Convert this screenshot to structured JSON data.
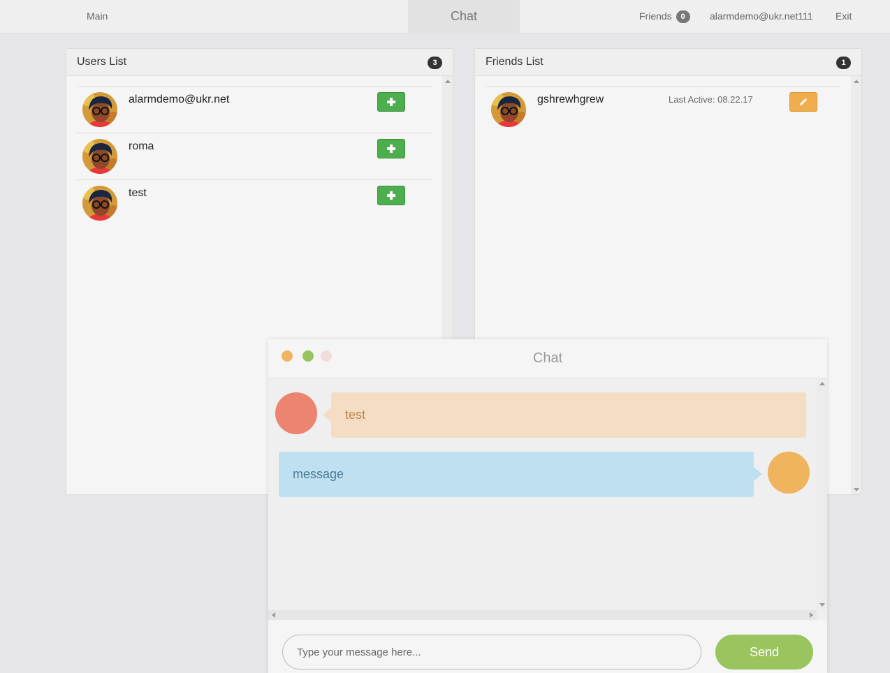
{
  "navbar": {
    "main": "Main",
    "chat": "Chat",
    "friends": "Friends",
    "friends_count": "0",
    "user": "alarmdemo@ukr.net111",
    "exit": "Exit"
  },
  "users_panel": {
    "title": "Users List",
    "count": "3",
    "items": [
      {
        "name": "alarmdemo@ukr.net"
      },
      {
        "name": "roma"
      },
      {
        "name": "test"
      }
    ]
  },
  "friends_panel": {
    "title": "Friends List",
    "count": "1",
    "items": [
      {
        "name": "gshrewhgrew",
        "last_active": "Last Active: 08.22.17"
      }
    ]
  },
  "chat": {
    "title": "Chat",
    "messages": [
      {
        "text": "test",
        "direction": "incoming",
        "avatar_color": "#eb8570"
      },
      {
        "text": "message",
        "direction": "outgoing",
        "avatar_color": "#f0b35e"
      }
    ],
    "input_placeholder": "Type your message here...",
    "send_label": "Send"
  },
  "colors": {
    "add_button": "#4cae4c",
    "edit_button": "#f0ad4e",
    "send_button": "#99c45e"
  }
}
